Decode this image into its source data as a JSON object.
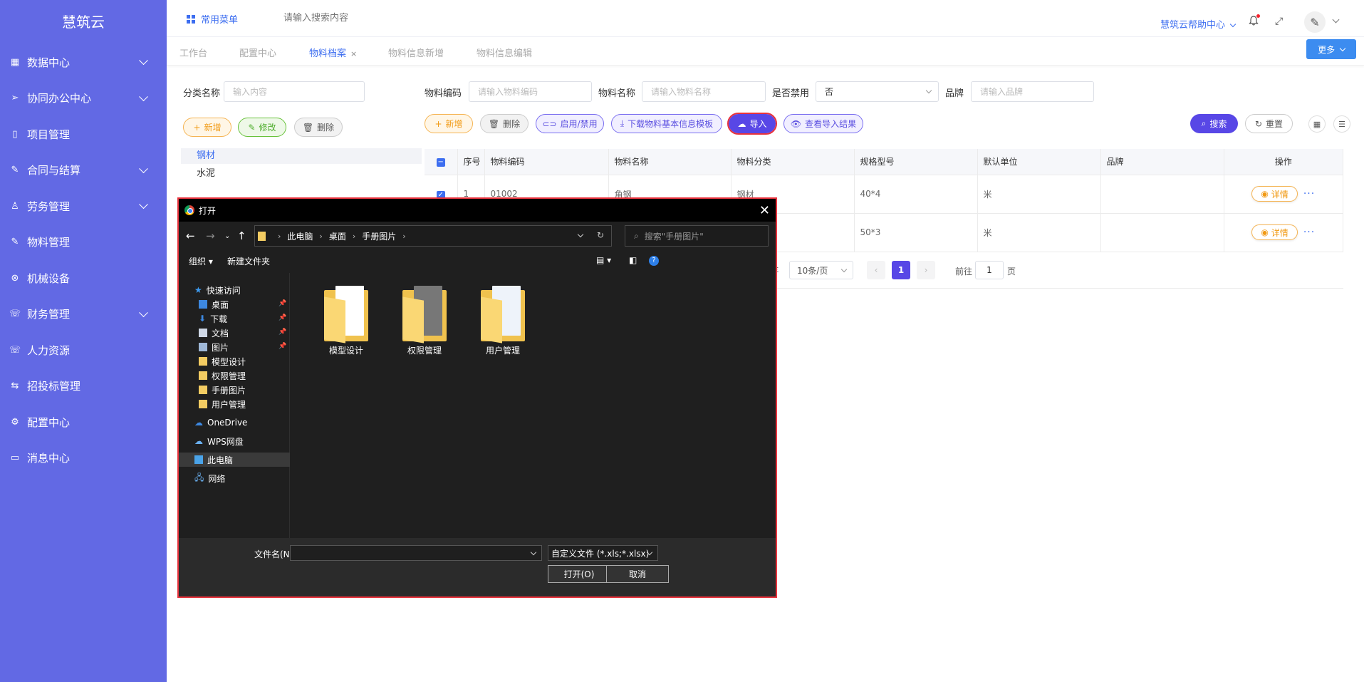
{
  "sidebar": {
    "logo": "慧筑云",
    "items": [
      {
        "label": "数据中心",
        "icon": "grid-icon",
        "expand": true
      },
      {
        "label": "协同办公中心",
        "icon": "send-icon",
        "expand": true
      },
      {
        "label": "项目管理",
        "icon": "book-icon",
        "expand": false
      },
      {
        "label": "合同与结算",
        "icon": "edit-icon",
        "expand": true
      },
      {
        "label": "劳务管理",
        "icon": "users-icon",
        "expand": true
      },
      {
        "label": "物料管理",
        "icon": "edit-icon",
        "expand": false
      },
      {
        "label": "机械设备",
        "icon": "close-circle-icon",
        "expand": false
      },
      {
        "label": "财务管理",
        "icon": "phone-icon",
        "expand": true
      },
      {
        "label": "人力资源",
        "icon": "phone-icon",
        "expand": false
      },
      {
        "label": "招投标管理",
        "icon": "swap-icon",
        "expand": false
      },
      {
        "label": "配置中心",
        "icon": "gear-icon",
        "expand": false
      },
      {
        "label": "消息中心",
        "icon": "message-icon",
        "expand": false
      }
    ]
  },
  "topbar": {
    "favorites": "常用菜单",
    "search_placeholder": "请输入搜索内容",
    "help": "慧筑云帮助中心"
  },
  "tabs": [
    {
      "label": "工作台",
      "active": false
    },
    {
      "label": "配置中心",
      "active": false
    },
    {
      "label": "物料档案",
      "active": true,
      "closable": "×"
    },
    {
      "label": "物料信息新增",
      "active": false
    },
    {
      "label": "物料信息编辑",
      "active": false
    }
  ],
  "more_button": "更多",
  "filters": {
    "category_label": "分类名称",
    "category_placeholder": "输入内容",
    "code_label": "物料编码",
    "code_placeholder": "请输入物料编码",
    "name_label": "物料名称",
    "name_placeholder": "请输入物料名称",
    "disabled_label": "是否禁用",
    "disabled_value": "否",
    "brand_label": "品牌",
    "brand_placeholder": "请输入品牌"
  },
  "left_buttons": {
    "add": "新增",
    "edit": "修改",
    "delete": "删除"
  },
  "toolbar": {
    "add": "新增",
    "delete": "删除",
    "toggle": "启用/禁用",
    "download": "下载物料基本信息模板",
    "import": "导入",
    "view_import": "查看导入结果",
    "search": "搜索",
    "reset": "重置"
  },
  "tree": [
    "钢材",
    "水泥"
  ],
  "table": {
    "headers": [
      "序号",
      "物料编码",
      "物料名称",
      "物料分类",
      "规格型号",
      "默认单位",
      "品牌",
      "操作"
    ],
    "rows": [
      {
        "no": "1",
        "code": "01002",
        "name": "角钢",
        "category": "钢材",
        "spec": "40*4",
        "unit": "米",
        "brand": "",
        "action": "详情"
      },
      {
        "no": "",
        "code": "",
        "name": "",
        "category": "",
        "spec": "50*3",
        "unit": "米",
        "brand": "",
        "action": "详情"
      }
    ]
  },
  "pagination": {
    "page_size": "10条/页",
    "current": "1",
    "goto_label": "前往",
    "goto_value": "1",
    "page_unit": "页",
    "truncated_prefix": "ɛ"
  },
  "dialog": {
    "title": "打开",
    "path": [
      "此电脑",
      "桌面",
      "手册图片"
    ],
    "search_placeholder": "搜索\"手册图片\"",
    "organize": "组织",
    "new_folder": "新建文件夹",
    "nav": {
      "quick_access": "快速访问",
      "items": [
        "桌面",
        "下载",
        "文档",
        "图片",
        "模型设计",
        "权限管理",
        "手册图片",
        "用户管理"
      ],
      "onedrive": "OneDrive",
      "wps": "WPS网盘",
      "this_pc": "此电脑",
      "network": "网络"
    },
    "folders": [
      "模型设计",
      "权限管理",
      "用户管理"
    ],
    "filename_label": "文件名(N):",
    "filetype": "自定义文件 (*.xls;*.xlsx)",
    "open": "打开(O)",
    "cancel": "取消"
  },
  "colors": {
    "sidebar": "#6269e4",
    "primary": "#3d6ef0",
    "highlight": "#e8323c"
  }
}
